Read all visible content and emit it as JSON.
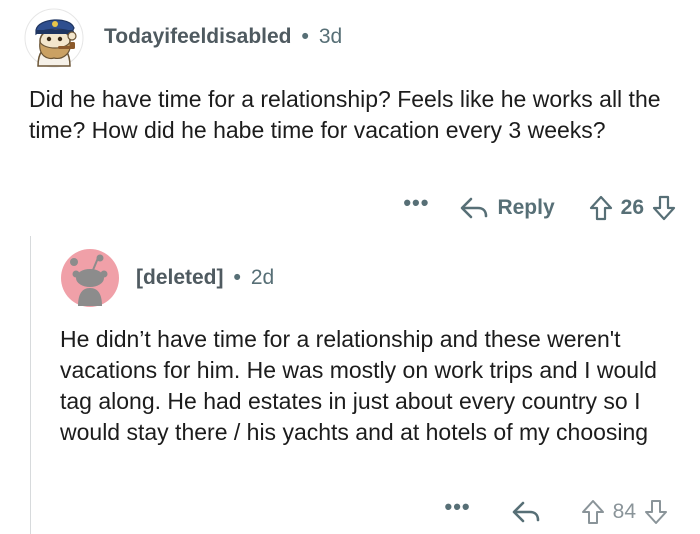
{
  "comments": [
    {
      "author": "Todayifeeldisabled",
      "separator": "•",
      "age": "3d",
      "body": "Did he have time for a relationship? Feels like he works all the time? How did he habe time for vacation every 3 weeks?",
      "more_label": "•••",
      "reply_label": "Reply",
      "score": "26",
      "avatar_icon": "snoo-captain-hat-icon"
    },
    {
      "author": "[deleted]",
      "separator": "•",
      "age": "2d",
      "body": "He didn’t have time for a relationship and these weren't vacations for him. He was mostly on work trips and I would tag along. He had estates in just about every country so I would stay there / his yachts and at hotels of my choosing",
      "more_label": "•••",
      "reply_label": "",
      "score": "84",
      "avatar_icon": "deleted-user-snoo-icon"
    }
  ],
  "colors": {
    "meta_gray": "#576f76",
    "text": "#1c1c1c",
    "thread_line": "#d7dadc",
    "deleted_avatar_bg": "#f0a0a8"
  }
}
